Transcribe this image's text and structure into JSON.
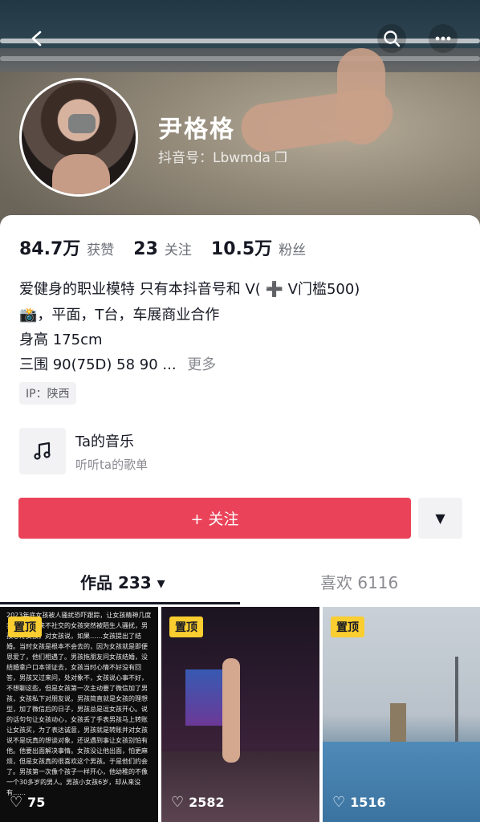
{
  "header": {
    "back_icon": "back-arrow-icon",
    "search_icon": "search-icon",
    "more_icon": "more-dots-icon"
  },
  "profile": {
    "name": "尹格格",
    "douyin_id": "抖音号：Lbwmda ❐"
  },
  "stats": [
    {
      "value": "84.7万",
      "label": "获赞"
    },
    {
      "value": "23",
      "label": "关注"
    },
    {
      "value": "10.5万",
      "label": "粉丝"
    }
  ],
  "bio": {
    "line1": "爱健身的职业模特 只有本抖音号和 V( ➕ V门槛500)",
    "line2": "📸，平面，T台，车展商业合作",
    "line3": "身高 175cm",
    "line4": "三围 90(75D) 58 90 ...",
    "more": "更多"
  },
  "ip": "IP：陕西",
  "music": {
    "title": "Ta的音乐",
    "subtitle": "听听ta的歌单"
  },
  "actions": {
    "follow_label": "+ 关注",
    "dropdown_icon": "▼"
  },
  "tabs": {
    "works": "作品 233 ▾",
    "likes": "喜欢 6116"
  },
  "grid": {
    "items": [
      {
        "pin": "置顶",
        "likes": "75",
        "text": "2023年底女孩被人骚扰恐吓跟踪，让女孩精神几度奔溃……从来不社交的女孩突然被陌生人骚扰，男孩心疼女孩，对女孩说，如果……女孩提出了结婚。当时女孩是根本不会去的，因为女孩就是即便恩爱了，他们相遇了。男孩拖朋友问女孩结婚，没结婚拿户口本领证去，女孩当时心情不好没有回答，男孩又过来问，处对象不，女孩说心事不好，不想聊这些，但是女孩第一次主动要了微信加了男孩，女孩私下对朋友说，男孩简直就是女孩的理想型，加了微信后的日子，男孩总是逗女孩开心。说的话句句让女孩动心，女孩丢了手表男孩马上转账让女孩买，为了表达诚意，男孩就是转账并对女孩说不是玩真的想谈对象，还说遇到事让女孩别怕有他。他要出面解决事情。女孩没让他出面，怕更麻烦，但是女孩真的很喜欢这个男孩。于是他们约会了。男孩第一次像个孩子一样开心，他幼稚的不像一个30多岁的男人。男孩小女孩6岁，却从来没有……"
      },
      {
        "pin": "置顶",
        "likes": "2582"
      },
      {
        "pin": "置顶",
        "likes": "1516"
      }
    ]
  }
}
